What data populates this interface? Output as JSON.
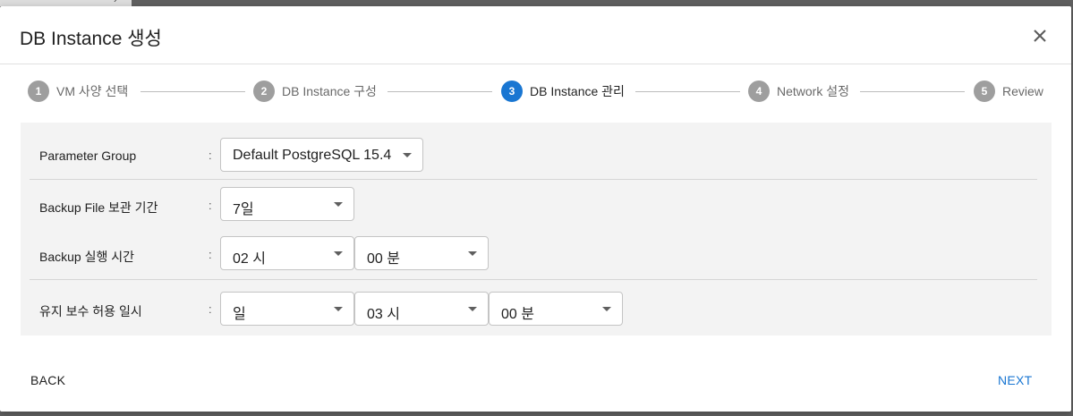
{
  "dialog": {
    "title": "DB Instance 생성"
  },
  "stepper": {
    "steps": [
      {
        "num": "1",
        "label": "VM 사양 선택"
      },
      {
        "num": "2",
        "label": "DB Instance 구성"
      },
      {
        "num": "3",
        "label": "DB Instance 관리"
      },
      {
        "num": "4",
        "label": "Network 설정"
      },
      {
        "num": "5",
        "label": "Review"
      }
    ],
    "active_step": 3
  },
  "form": {
    "colon": ":",
    "parameter_group": {
      "label": "Parameter Group",
      "value": "Default PostgreSQL 15.4"
    },
    "backup_retention": {
      "label": "Backup File 보관 기간",
      "value": "7일"
    },
    "backup_time": {
      "label": "Backup 실행 시간",
      "hour": "02 시",
      "minute": "00 분"
    },
    "maintenance": {
      "label": "유지 보수 허용 일시",
      "day": "일",
      "hour": "03 시",
      "minute": "00 분"
    }
  },
  "footer": {
    "back_label": "BACK",
    "next_label": "NEXT"
  },
  "colors": {
    "accent": "#1976d2",
    "step_inactive": "#9e9e9e",
    "panel_bg": "#f3f3f3"
  },
  "icons": {
    "close": "close-icon",
    "dropdown": "chevron-down-icon"
  }
}
